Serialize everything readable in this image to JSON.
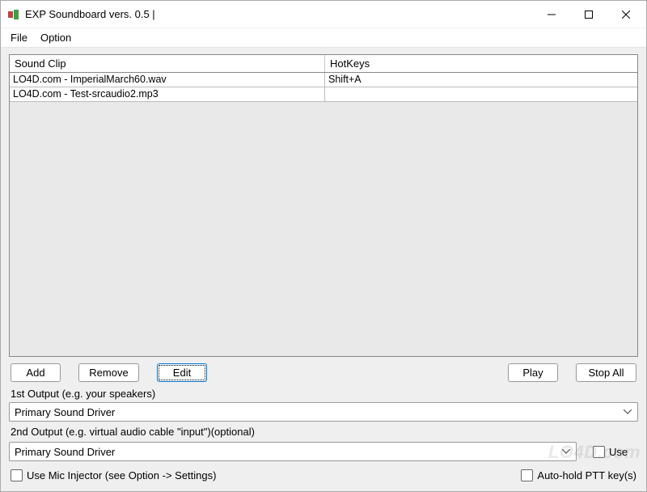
{
  "window": {
    "title": "EXP Soundboard vers. 0.5 |"
  },
  "menubar": {
    "file": "File",
    "option": "Option"
  },
  "table": {
    "headers": {
      "clip": "Sound Clip",
      "hotkeys": "HotKeys"
    },
    "rows": [
      {
        "clip": "LO4D.com - ImperialMarch60.wav",
        "hotkeys": "Shift+A"
      },
      {
        "clip": "LO4D.com - Test-srcaudio2.mp3",
        "hotkeys": ""
      }
    ]
  },
  "buttons": {
    "add": "Add",
    "remove": "Remove",
    "edit": "Edit",
    "play": "Play",
    "stopAll": "Stop All"
  },
  "output1": {
    "label": "1st Output (e.g. your speakers)",
    "value": "Primary Sound Driver"
  },
  "output2": {
    "label": "2nd Output (e.g. virtual audio cable \"input\")(optional)",
    "value": "Primary Sound Driver",
    "useLabel": "Use"
  },
  "bottom": {
    "micInjector": "Use Mic Injector (see Option -> Settings)",
    "autoHold": "Auto-hold PTT key(s)"
  },
  "watermark": "LO4D.com"
}
